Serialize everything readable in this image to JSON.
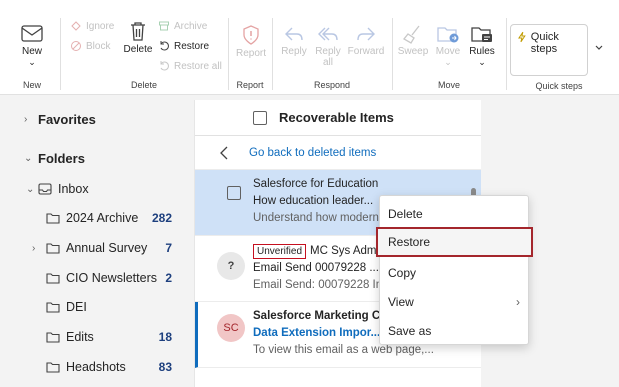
{
  "ribbon": {
    "new": {
      "label": "New",
      "chevron": "⌄",
      "group": "New"
    },
    "delete_group": {
      "group": "Delete",
      "ignore": "Ignore",
      "block": "Block",
      "delete": "Delete",
      "archive": "Archive",
      "restore": "Restore",
      "restore_all": "Restore all"
    },
    "report": {
      "label": "Report",
      "group": "Report"
    },
    "respond": {
      "group": "Respond",
      "reply": "Reply",
      "reply_all_1": "Reply",
      "reply_all_2": "all",
      "forward": "Forward"
    },
    "move": {
      "group": "Move",
      "sweep": "Sweep",
      "move": "Move",
      "rules": "Rules",
      "chevron": "⌄"
    },
    "quick_steps": {
      "label": "Quick steps",
      "group": "Quick steps"
    }
  },
  "nav": {
    "favorites": "Favorites",
    "folders": "Folders",
    "inbox": "Inbox",
    "folders_list": [
      {
        "name": "2024 Archive",
        "count": "282"
      },
      {
        "name": "Annual Survey",
        "count": "7"
      },
      {
        "name": "CIO Newsletters",
        "count": "2"
      },
      {
        "name": "DEI",
        "count": ""
      },
      {
        "name": "Edits",
        "count": "18"
      },
      {
        "name": "Headshots",
        "count": "83"
      }
    ]
  },
  "list": {
    "title": "Recoverable Items",
    "back": "Go back to deleted items",
    "messages": [
      {
        "sender": "Salesforce for Education",
        "subject": "How education leader...",
        "preview": "Understand how modern"
      },
      {
        "badge": "Unverified",
        "sender": "MC Sys Admi",
        "subject": "Email Send 00079228 ...",
        "preview": "Email Send: 00079228 Init",
        "avatar": "?"
      },
      {
        "sender": "Salesforce Marketing Clo",
        "subject": "Data Extension Impor...",
        "preview": "To view this email as a web page,...",
        "avatar": "SC"
      }
    ]
  },
  "menu": {
    "items": [
      {
        "label": "Delete"
      },
      {
        "label": "Restore"
      },
      {
        "label": "Copy"
      },
      {
        "label": "View",
        "arrow": "›"
      },
      {
        "label": "Save as"
      }
    ]
  },
  "colors": {
    "accent": "#0f6cbd",
    "selected": "#cfe1f7",
    "highlight": "#a4262c",
    "avatar_sc": "#f1c6c6"
  }
}
